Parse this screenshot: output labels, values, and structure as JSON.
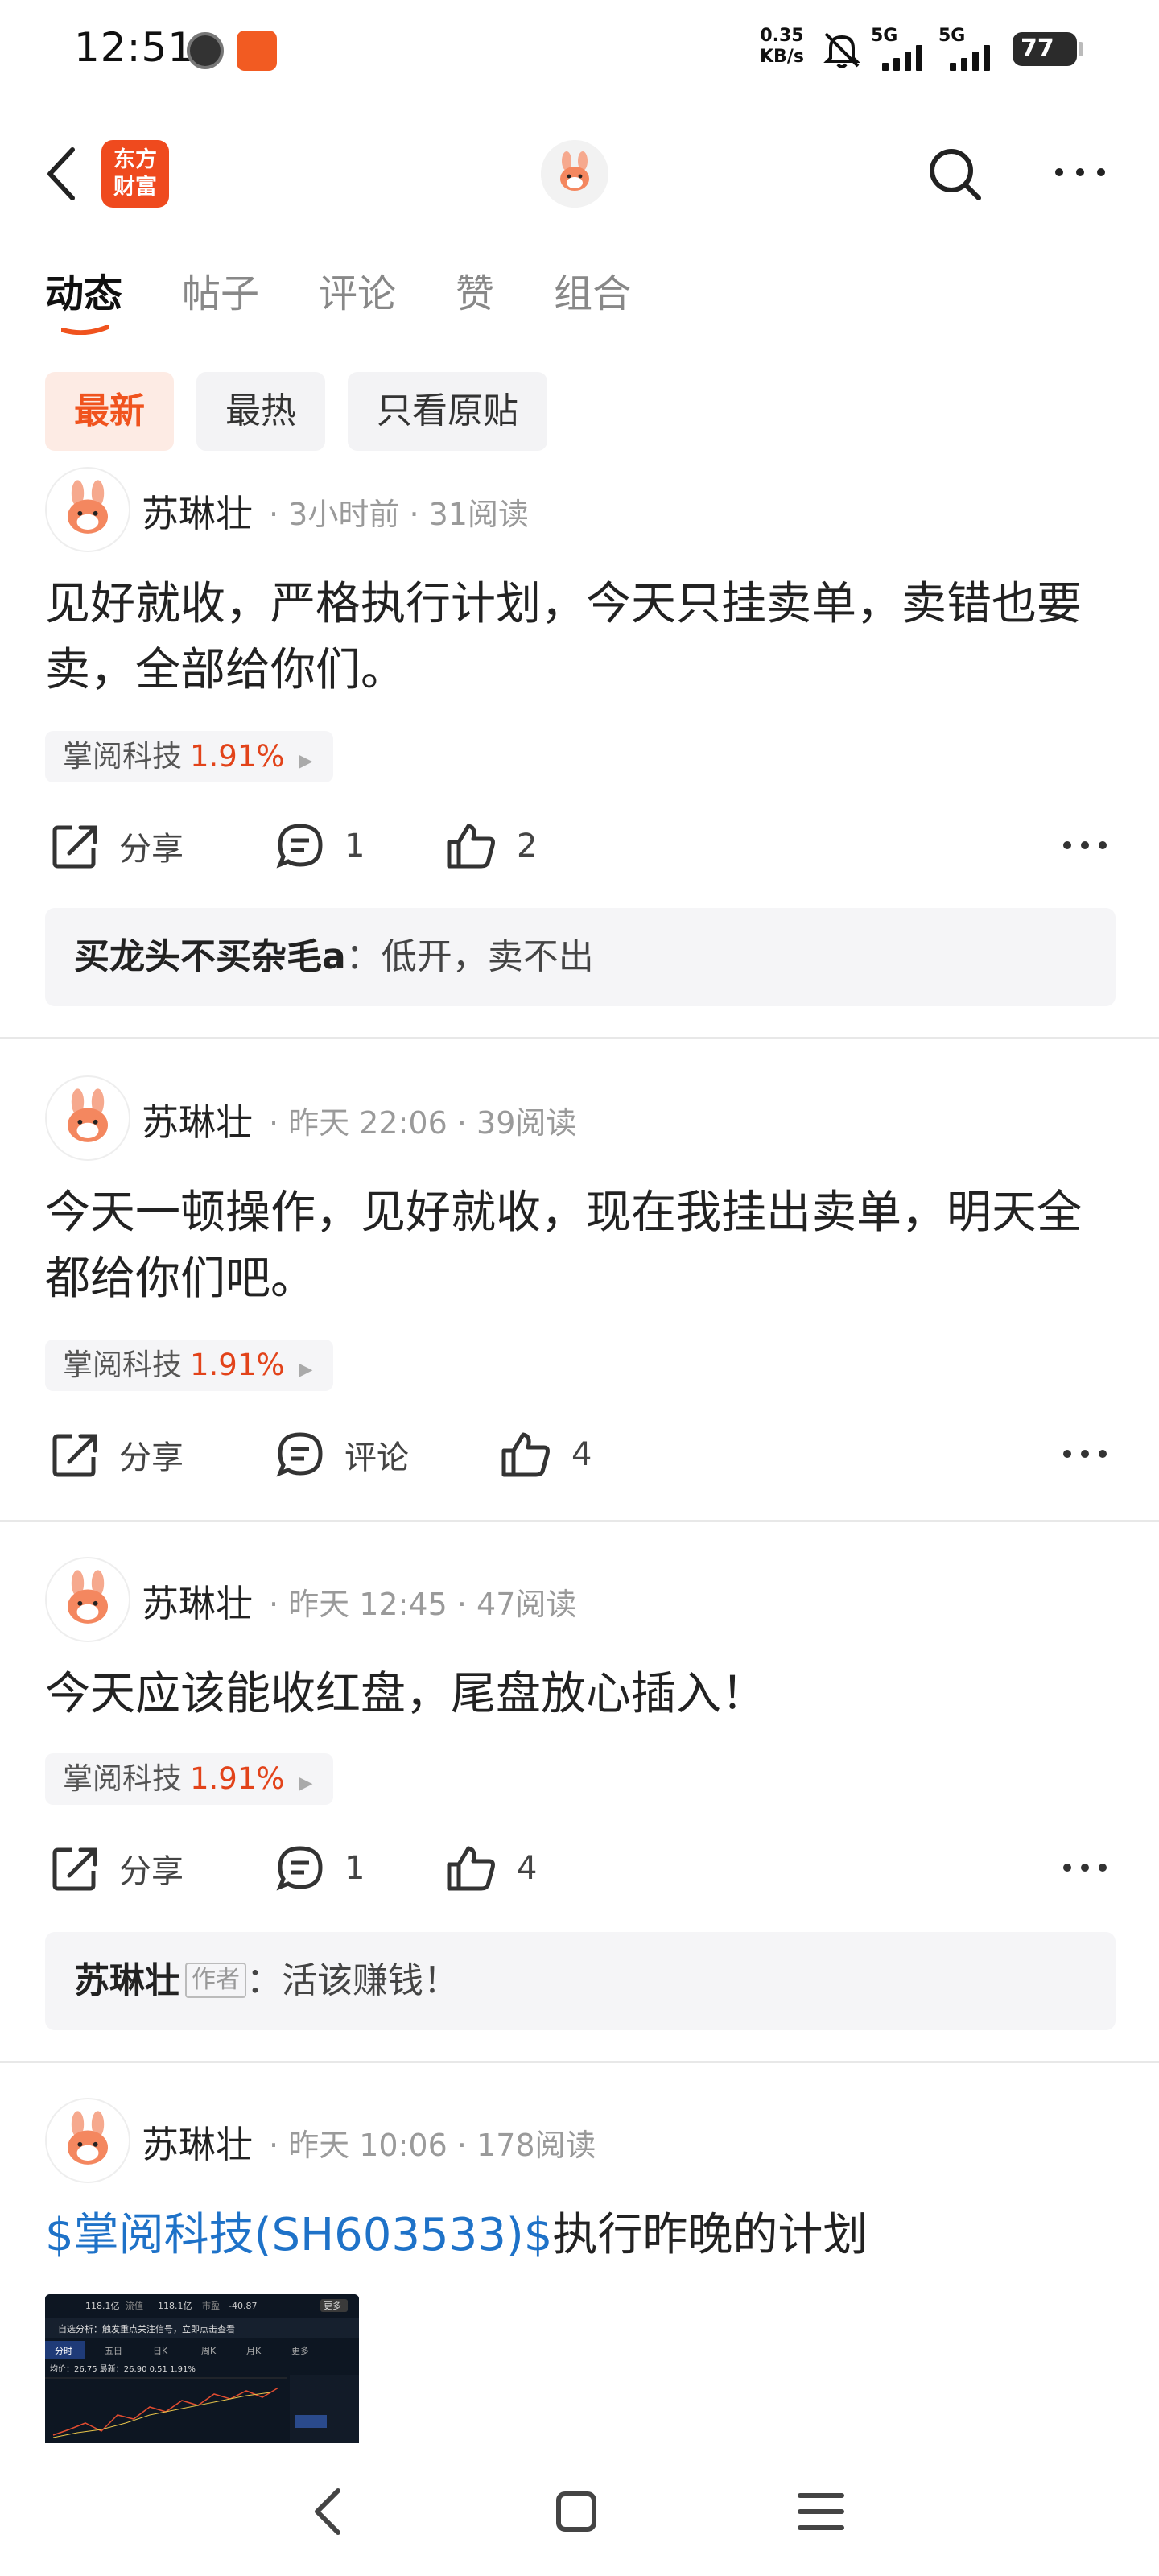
{
  "status_bar": {
    "time": "12:51",
    "net_speed_value": "0.35",
    "net_speed_unit": "KB/s",
    "sim1": "5G",
    "sim2": "5G",
    "battery": "77"
  },
  "header": {
    "logo_line1": "东方",
    "logo_line2": "财富",
    "icons": [
      "back-icon",
      "search-icon",
      "more-icon"
    ]
  },
  "tabs": [
    {
      "label": "动态",
      "active": true
    },
    {
      "label": "帖子",
      "active": false
    },
    {
      "label": "评论",
      "active": false
    },
    {
      "label": "赞",
      "active": false
    },
    {
      "label": "组合",
      "active": false
    }
  ],
  "filters": [
    {
      "label": "最新",
      "active": true
    },
    {
      "label": "最热",
      "active": false
    },
    {
      "label": "只看原贴",
      "active": false
    }
  ],
  "accent_color": "#f0531e",
  "stock_color": "#e2431a",
  "link_color": "#1e72c8",
  "actions": {
    "share": "分享",
    "comment": "评论"
  },
  "posts": [
    {
      "user": "苏琳壮",
      "time": "3小时前",
      "reads": "31阅读",
      "text": "见好就收，严格执行计划，今天只挂卖单，卖错也要卖，全部给你们。",
      "stock": {
        "name": "掌阅科技",
        "change": "1.91%"
      },
      "comment_count": "1",
      "like_count": "2",
      "top_comment": {
        "user": "买龙头不买杂毛a",
        "sep": "：",
        "text": "低开，卖不出"
      }
    },
    {
      "user": "苏琳壮",
      "time": "昨天 22:06",
      "reads": "39阅读",
      "text": "今天一顿操作，见好就收，现在我挂出卖单，明天全都给你们吧。",
      "stock": {
        "name": "掌阅科技",
        "change": "1.91%"
      },
      "comment_label": "评论",
      "like_count": "4"
    },
    {
      "user": "苏琳壮",
      "time": "昨天 12:45",
      "reads": "47阅读",
      "text": "今天应该能收红盘，尾盘放心插入！",
      "stock": {
        "name": "掌阅科技",
        "change": "1.91%"
      },
      "comment_count": "1",
      "like_count": "4",
      "top_comment": {
        "user": "苏琳壮",
        "badge": "作者",
        "sep": "：",
        "text": "活该赚钱！"
      }
    },
    {
      "user": "苏琳壮",
      "time": "昨天 10:06",
      "reads": "178阅读",
      "link_text": "$掌阅科技(SH603533)$",
      "text": "执行昨晚的计划",
      "thumbnail": {
        "row1": [
          "118.1亿",
          "流值",
          "118.1亿",
          "市盈",
          "-40.87",
          "更多"
        ],
        "banner": "自选分析：触发重点关注信号，立即点击查看",
        "tabs": [
          "分时",
          "五日",
          "日K",
          "周K",
          "月K",
          "更多"
        ],
        "price_line": "均价：26.75  最新：26.90  0.51  1.91%"
      }
    }
  ]
}
